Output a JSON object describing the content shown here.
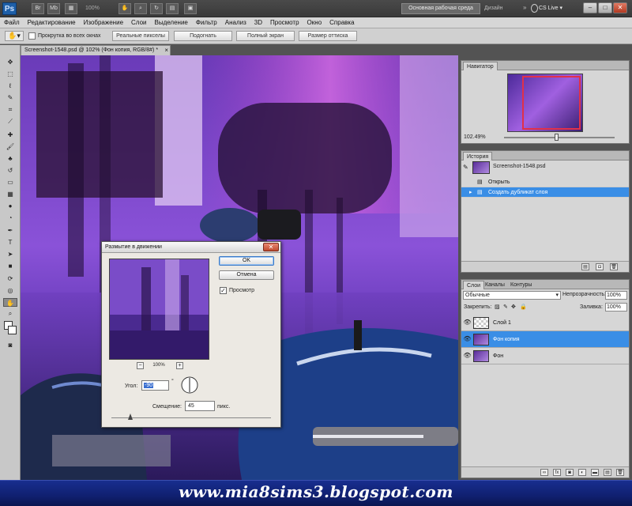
{
  "app": {
    "logo": "Ps",
    "zoom": "100%",
    "workspace": "Основная рабочая среда",
    "design": "Дизайн",
    "cs_live": "CS Live ▾",
    "win_min": "–",
    "win_max": "□",
    "win_close": "✕"
  },
  "menu": [
    "Файл",
    "Редактирование",
    "Изображение",
    "Слои",
    "Выделение",
    "Фильтр",
    "Анализ",
    "3D",
    "Просмотр",
    "Окно",
    "Справка"
  ],
  "options": {
    "scroll_all": "Прокрутка во всех окнах",
    "buttons": [
      "Реальные пикселы",
      "Подогнать",
      "Полный экран",
      "Размер оттиска"
    ]
  },
  "document": {
    "tab_title": "Screenshot-1548.psd @ 102% (Фон копия, RGB/8#) *",
    "close": "×"
  },
  "navigator": {
    "title": "Навигатор",
    "zoom": "102.49%"
  },
  "history": {
    "title": "История",
    "snapshot": "Screenshot-1548.psd",
    "items": [
      "Открыть",
      "Создать дубликат слоя"
    ]
  },
  "layers": {
    "tabs": [
      "Слои",
      "Каналы",
      "Контуры"
    ],
    "blend_mode": "Обычные",
    "opacity_label": "Непрозрачность:",
    "opacity_value": "100%",
    "lock_label": "Закрепить:",
    "fill_label": "Заливка:",
    "fill_value": "100%",
    "items": [
      "Слой 1",
      "Фон копия",
      "Фон"
    ],
    "footer_icons": [
      "link-icon",
      "fx",
      "mask-icon",
      "adjustment-icon",
      "group-icon",
      "new-layer-icon",
      "trash-icon"
    ]
  },
  "dialog": {
    "title": "Размытие в движении",
    "ok": "OK",
    "cancel": "Отмена",
    "preview_label": "Просмотр",
    "preview_checked": true,
    "zoom_minus": "−",
    "zoom_plus": "+",
    "zoom": "100%",
    "angle_label": "Угол:",
    "angle_value": "-90",
    "deg": "°",
    "offset_label": "Смещение:",
    "offset_value": "45",
    "offset_unit": "пикс."
  },
  "banner": "www.mia8sims3.blogspot.com",
  "colors": {
    "accent": "#3a8ee6",
    "banner": "#102070",
    "canvas_purple": "#7a3cd0"
  }
}
